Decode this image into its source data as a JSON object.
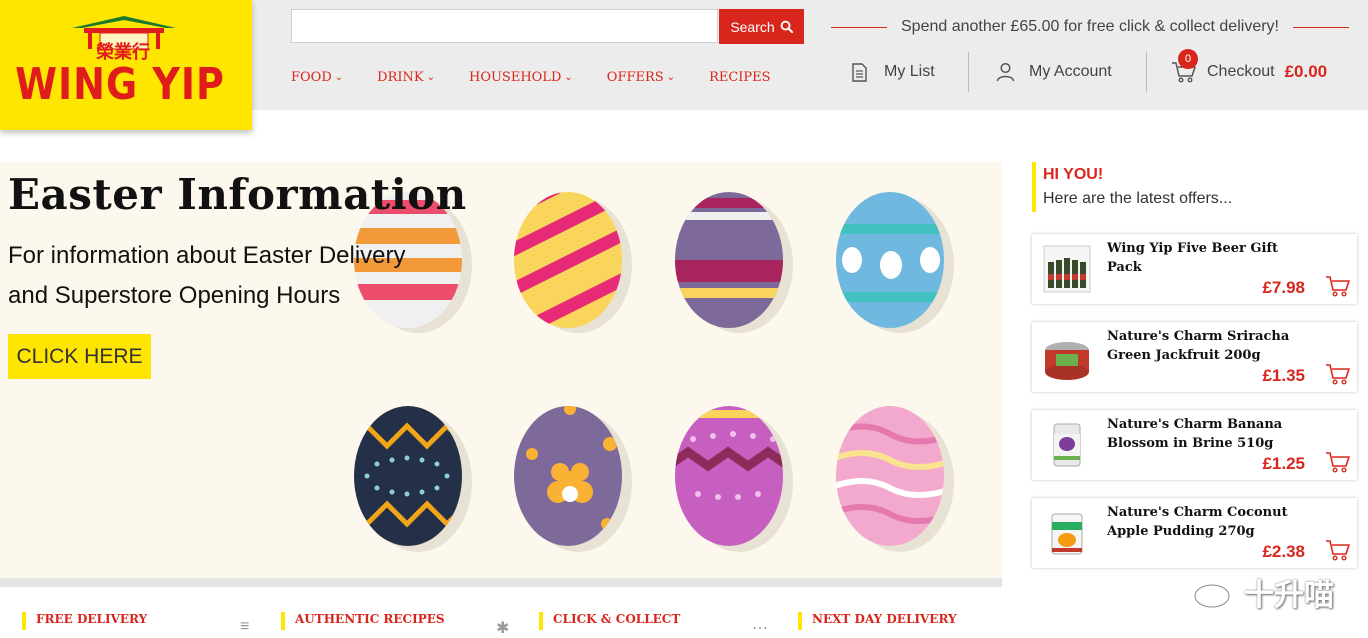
{
  "colors": {
    "brand_red": "#d9261c",
    "brand_yellow": "#ffe600",
    "header_bg": "#ececec",
    "hero_bg": "#fdf8ed"
  },
  "logo": {
    "text": "WING YIP",
    "chinese": "榮業行"
  },
  "search": {
    "placeholder": "",
    "button_label": "Search",
    "icon": "search-icon"
  },
  "promo": {
    "text": "Spend another £65.00 for free click & collect delivery!"
  },
  "nav": [
    {
      "label": "FOOD",
      "has_dropdown": true
    },
    {
      "label": "DRINK",
      "has_dropdown": true
    },
    {
      "label": "HOUSEHOLD",
      "has_dropdown": true
    },
    {
      "label": "OFFERS",
      "has_dropdown": true
    },
    {
      "label": "RECIPES",
      "has_dropdown": false
    }
  ],
  "utility": {
    "my_list": {
      "label": "My List",
      "icon": "list-icon"
    },
    "my_account": {
      "label": "My Account",
      "icon": "user-icon"
    },
    "checkout": {
      "label": "Checkout",
      "amount": "£0.00",
      "badge": "0",
      "icon": "cart-icon"
    }
  },
  "hero": {
    "title": "Easter Information",
    "subtitle": "For information about Easter Delivery and Superstore Opening Hours",
    "cta": "CLICK HERE"
  },
  "sidebar": {
    "greeting": "HI YOU!",
    "subtext": "Here are the latest offers...",
    "offers": [
      {
        "name": "Wing Yip Five Beer Gift Pack",
        "price": "£7.98"
      },
      {
        "name": "Nature's Charm Sriracha Green Jackfruit 200g",
        "price": "£1.35"
      },
      {
        "name": "Nature's Charm Banana Blossom in Brine 510g",
        "price": "£1.25"
      },
      {
        "name": "Nature's Charm Coconut Apple Pudding 270g",
        "price": "£2.38"
      }
    ]
  },
  "features": [
    {
      "label": "FREE DELIVERY"
    },
    {
      "label": "AUTHENTIC RECIPES"
    },
    {
      "label": "CLICK & COLLECT"
    },
    {
      "label": "NEXT DAY DELIVERY"
    }
  ],
  "watermark": {
    "text": "十升喵"
  }
}
